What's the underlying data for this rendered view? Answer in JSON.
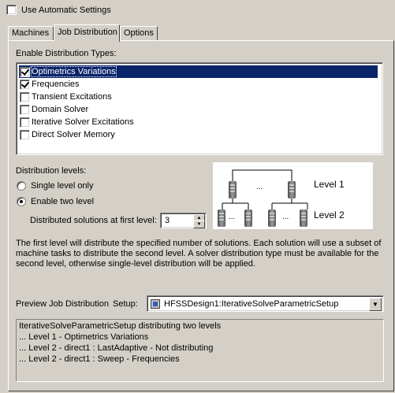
{
  "use_auto_settings": {
    "label": "Use Automatic Settings",
    "checked": false
  },
  "tabs": [
    {
      "label": "Machines",
      "active": false
    },
    {
      "label": "Job Distribution",
      "active": true
    },
    {
      "label": "Options",
      "active": false
    }
  ],
  "enable_types": {
    "label": "Enable Distribution Types:",
    "items": [
      {
        "label": "Optimetrics Variations",
        "checked": true,
        "selected": true
      },
      {
        "label": "Frequencies",
        "checked": true,
        "selected": false
      },
      {
        "label": "Transient Excitations",
        "checked": false,
        "selected": false
      },
      {
        "label": "Domain Solver",
        "checked": false,
        "selected": false
      },
      {
        "label": "Iterative Solver Excitations",
        "checked": false,
        "selected": false
      },
      {
        "label": "Direct Solver Memory",
        "checked": false,
        "selected": false
      }
    ]
  },
  "distribution_levels": {
    "label": "Distribution levels:",
    "single": {
      "label": "Single level only",
      "selected": false
    },
    "two": {
      "label": "Enable two level",
      "selected": true
    },
    "first_level_label": "Distributed solutions at first level:",
    "first_level_value": "3"
  },
  "diagram": {
    "level1": "Level 1",
    "level2": "Level 2",
    "ellipsis": "..."
  },
  "description": "The first level will distribute the specified number of solutions. Each solution will use a subset of machine tasks to distribute the second level. A solver distribution type must be available for the second level, otherwise single-level distribution will be applied.",
  "preview": {
    "label": "Preview Job Distribution",
    "setup_label": "Setup:",
    "setup_value": "HFSSDesign1:IterativeSolveParametricSetup",
    "lines": [
      "IterativeSolveParametricSetup distributing two levels",
      "... Level 1 - Optimetrics Variations",
      "... Level 2 - direct1 : LastAdaptive - Not distributing",
      "... Level 2 - direct1 : Sweep - Frequencies"
    ]
  }
}
